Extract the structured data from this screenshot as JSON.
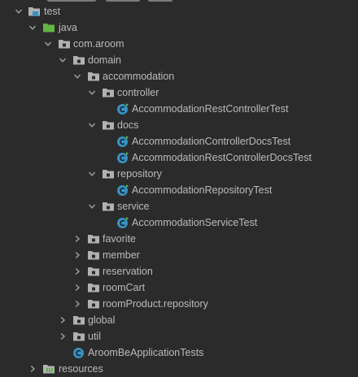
{
  "tree": {
    "test_root": "test",
    "java": "java",
    "package_root": "com.aroom",
    "domain": "domain",
    "accommodation": "accommodation",
    "controller": "controller",
    "controller_test": "AccommodationRestControllerTest",
    "docs": "docs",
    "docs_test_1": "AccommodationControllerDocsTest",
    "docs_test_2": "AccommodationRestControllerDocsTest",
    "repository": "repository",
    "repository_test": "AccommodationRepositoryTest",
    "service": "service",
    "service_test": "AccommodationServiceTest",
    "favorite": "favorite",
    "member": "member",
    "reservation": "reservation",
    "roomCart": "roomCart",
    "roomProduct_repository": "roomProduct.repository",
    "global": "global",
    "util": "util",
    "app_tests": "AroomBeApplicationTests",
    "resources": "resources"
  },
  "colors": {
    "background": "#2b2b2b",
    "text": "#bbbbbb",
    "folder": "#afb1b3",
    "source_folder_green": "#62b543",
    "test_root_blue": "#3592c4",
    "class_badge": "#3592c4",
    "arrow": "#a0a0a0"
  },
  "icons": {
    "expanded": "chevron-down-icon",
    "collapsed": "chevron-right-icon",
    "folder": "folder-icon",
    "package": "package-folder-icon",
    "source_root": "green-source-folder-icon",
    "test_root": "test-root-folder-icon",
    "class": "test-class-icon",
    "resources": "resources-folder-icon"
  }
}
